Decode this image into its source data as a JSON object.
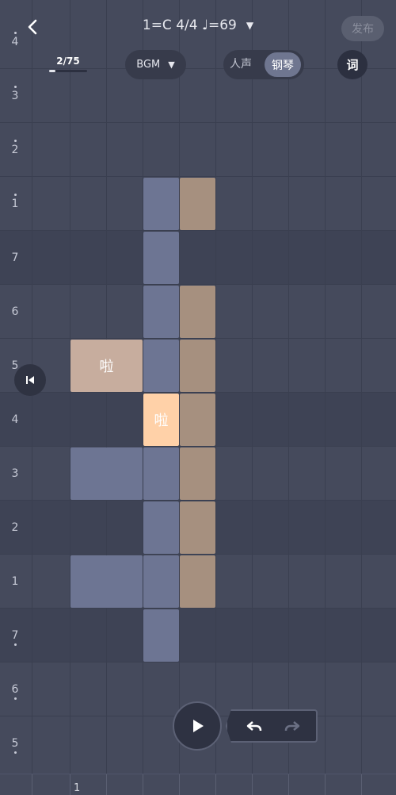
{
  "header": {
    "title": "1=C 4/4 ♩=69",
    "publish_label": "发布"
  },
  "counter": {
    "label": "2/75",
    "progress": 0.027
  },
  "bgm": {
    "label": "BGM"
  },
  "track_toggle": {
    "vocal_label": "人声",
    "piano_label": "钢琴",
    "selected": "钢琴"
  },
  "lyric_button": {
    "label": "词"
  },
  "pitch_rows": [
    {
      "label": "4",
      "dots": "high"
    },
    {
      "label": "3",
      "dots": "high"
    },
    {
      "label": "2",
      "dots": "high"
    },
    {
      "label": "1",
      "dots": "high"
    },
    {
      "label": "7",
      "dots": "none"
    },
    {
      "label": "6",
      "dots": "none"
    },
    {
      "label": "5",
      "dots": "none"
    },
    {
      "label": "4",
      "dots": "none"
    },
    {
      "label": "3",
      "dots": "none"
    },
    {
      "label": "2",
      "dots": "none"
    },
    {
      "label": "1",
      "dots": "none"
    },
    {
      "label": "7",
      "dots": "low"
    },
    {
      "label": "6",
      "dots": "low"
    },
    {
      "label": "5",
      "dots": "low"
    }
  ],
  "notes": {
    "lyric_note_text": "啦",
    "active_note_text": "啦"
  },
  "ruler": {
    "bar_number": "1"
  },
  "colors": {
    "background": "#454a5c",
    "vocal_note": "#6d7593",
    "piano_note": "#a6907f",
    "active_note": "#ffd1a8"
  },
  "icons": {
    "back": "chevron-left-icon",
    "dropdown": "caret-down-icon",
    "skip_start": "skip-to-start-icon",
    "play": "play-icon",
    "undo": "undo-icon",
    "redo": "redo-icon"
  }
}
